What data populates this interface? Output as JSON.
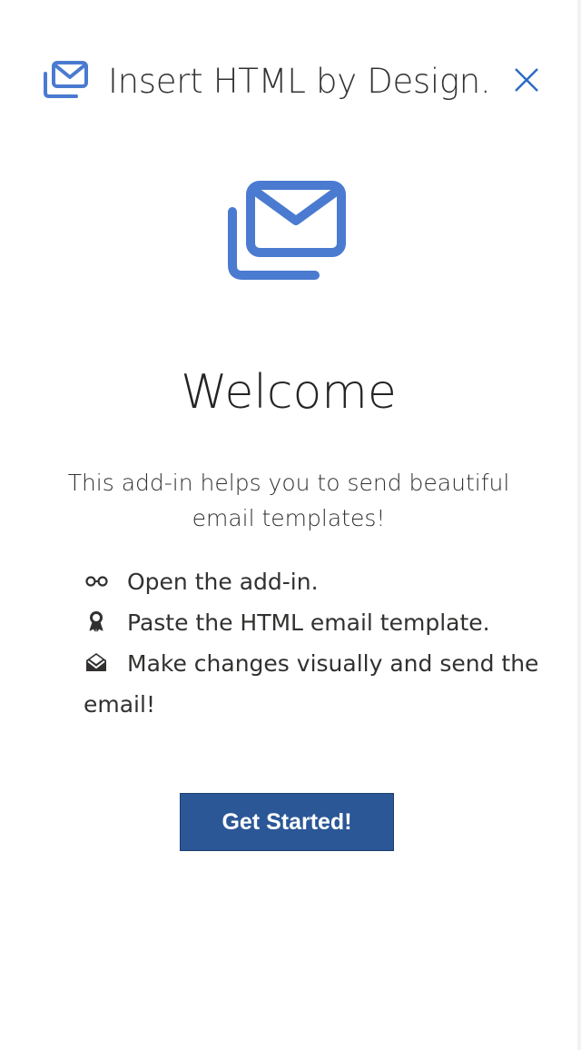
{
  "header": {
    "title": "Insert HTML by Design...",
    "logo_icon": "mail-stack-icon",
    "close_icon": "close-icon"
  },
  "hero": {
    "icon": "mail-stack-icon"
  },
  "main": {
    "heading": "Welcome",
    "description": "This add-in helps you to send beautiful email templates!",
    "steps": [
      {
        "icon": "glasses-icon",
        "label": "Open the add-in."
      },
      {
        "icon": "ribbon-icon",
        "label": "Paste the HTML email template."
      },
      {
        "icon": "open-envelope-icon",
        "label": "Make changes visually and send the email!"
      }
    ],
    "cta_label": "Get Started!"
  },
  "colors": {
    "accent": "#4a7bd0",
    "button": "#2b5797",
    "text": "#323130"
  }
}
